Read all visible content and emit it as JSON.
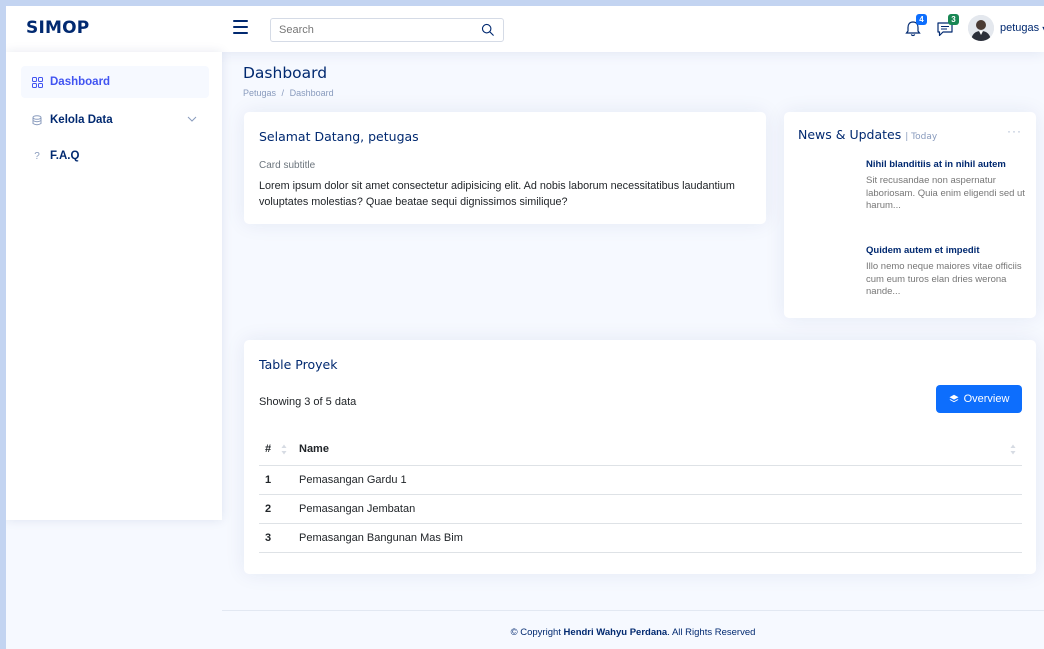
{
  "header": {
    "logo": "SIMOP",
    "search_placeholder": "Search",
    "notifications_count": "4",
    "messages_count": "3",
    "profile_name": "petugas"
  },
  "sidebar": {
    "items": [
      {
        "label": "Dashboard",
        "icon": "grid-icon"
      },
      {
        "label": "Kelola Data",
        "icon": "database-icon"
      },
      {
        "label": "F.A.Q",
        "icon": "question-icon"
      }
    ]
  },
  "page": {
    "title": "Dashboard",
    "breadcrumb": [
      "Petugas",
      "/",
      "Dashboard"
    ]
  },
  "welcome_card": {
    "title": "Selamat Datang, petugas",
    "subtitle": "Card subtitle",
    "text": "Lorem ipsum dolor sit amet consectetur adipisicing elit. Ad nobis laborum necessitatibus laudantium voluptates molestias? Quae beatae sequi dignissimos similique?"
  },
  "news": {
    "title": "News & Updates",
    "filter": "| Today",
    "items": [
      {
        "title": "Nihil blanditiis at in nihil autem",
        "desc": "Sit recusandae non aspernatur laboriosam. Quia enim eligendi sed ut harum..."
      },
      {
        "title": "Quidem autem et impedit",
        "desc": "Illo nemo neque maiores vitae officiis cum eum turos elan dries werona nande..."
      }
    ]
  },
  "project_table": {
    "title": "Table Proyek",
    "showing": "Showing 3 of 5 data",
    "button_label": "Overview",
    "columns": [
      "#",
      "Name"
    ],
    "rows": [
      {
        "num": "1",
        "name": "Pemasangan Gardu 1"
      },
      {
        "num": "2",
        "name": "Pemasangan Jembatan"
      },
      {
        "num": "3",
        "name": "Pemasangan Bangunan Mas Bim"
      }
    ]
  },
  "footer": {
    "prefix": "© Copyright ",
    "author": "Hendri Wahyu Perdana",
    "suffix": ". All Rights Reserved"
  },
  "colors": {
    "primary": "#4154f1",
    "navy": "#012970",
    "button": "#0d6efd",
    "badge_notif": "#0d6efd",
    "badge_msg": "#198754"
  }
}
